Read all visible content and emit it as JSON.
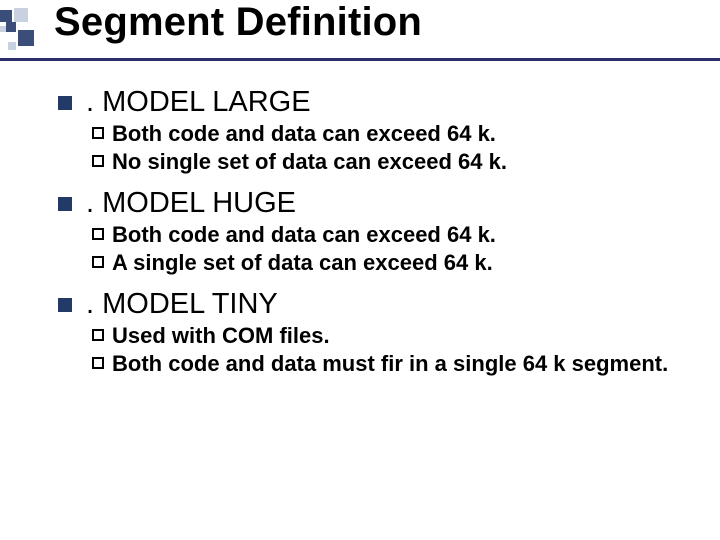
{
  "title": "Segment Definition",
  "sections": [
    {
      "heading": ". MODEL LARGE",
      "items": [
        "Both code and data can exceed 64 k.",
        "No single set of data can exceed 64 k."
      ]
    },
    {
      "heading": " . MODEL HUGE",
      "items": [
        "Both code and data can exceed 64 k.",
        "A single set of data can exceed 64 k."
      ]
    },
    {
      "heading": ". MODEL TINY",
      "items": [
        "Used with COM files.",
        "Both code and data must fir in a single 64 k segment."
      ]
    }
  ]
}
